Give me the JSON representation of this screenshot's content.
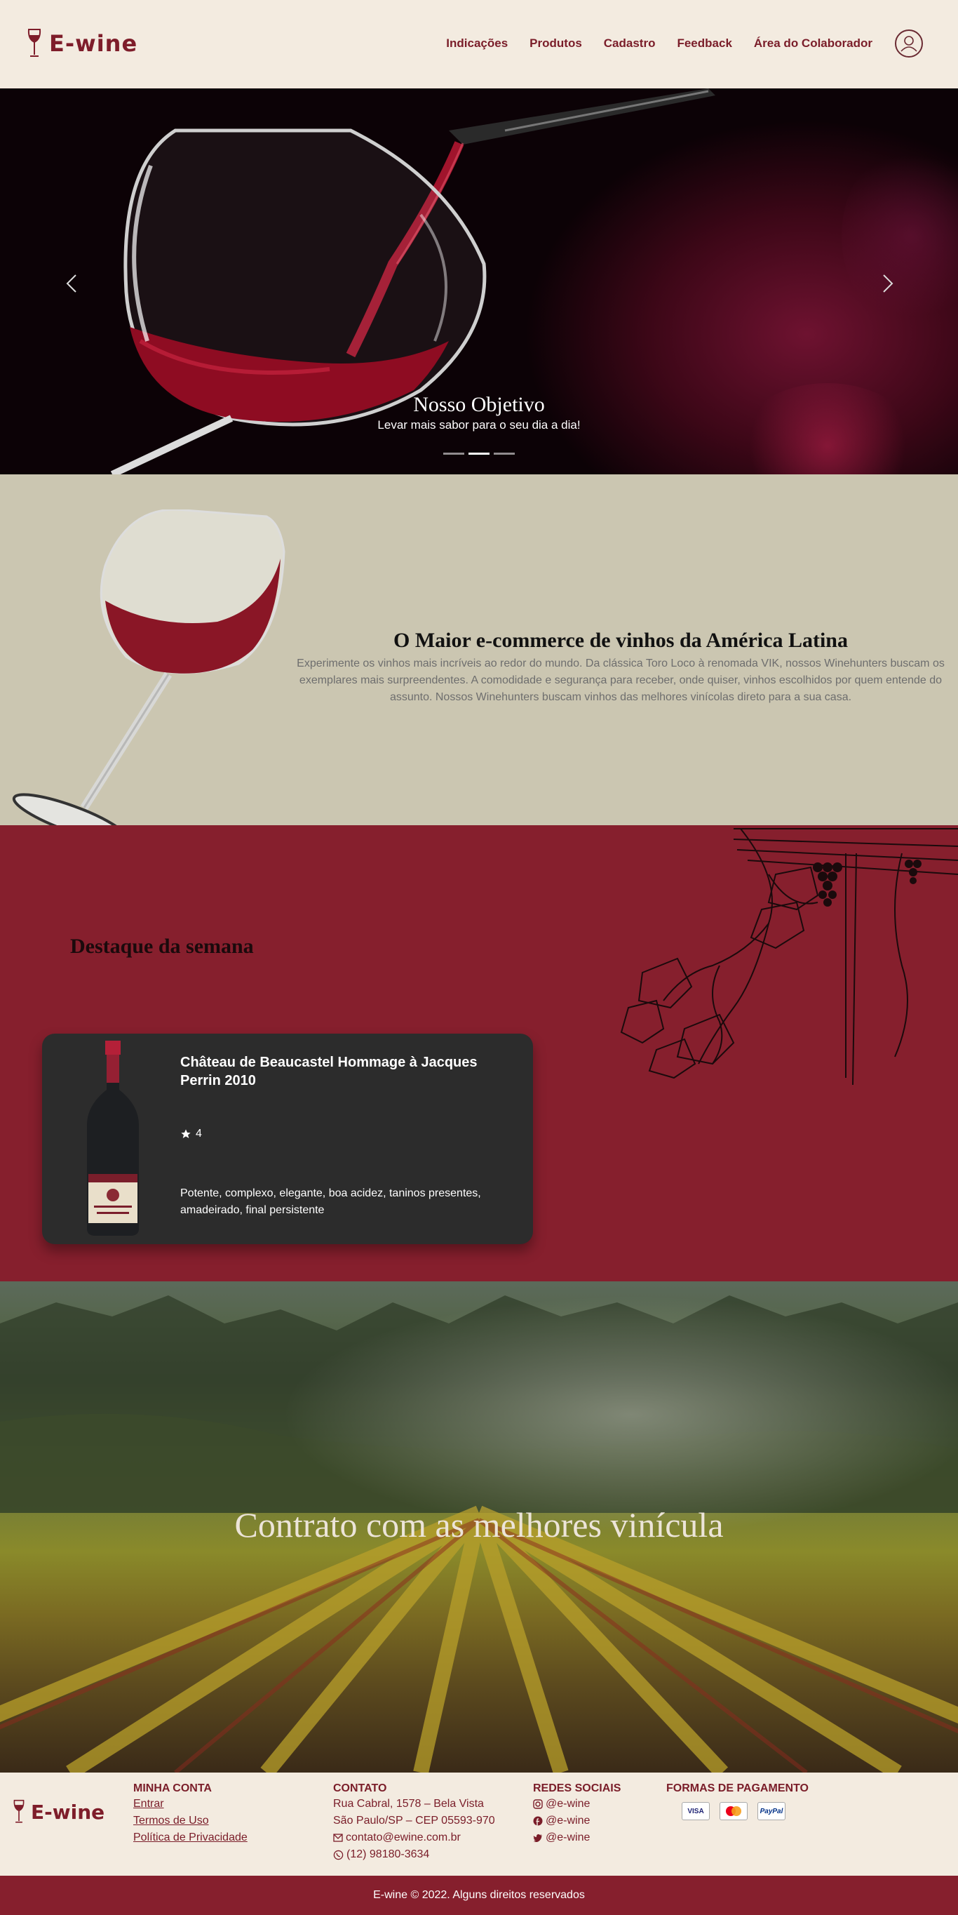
{
  "brand": {
    "name": "E-wine",
    "color": "#7e1d2a"
  },
  "nav": {
    "links": [
      "Indicações",
      "Produtos",
      "Cadastro",
      "Feedback",
      "Área do Colaborador"
    ],
    "profile_icon": "user-circle-icon"
  },
  "hero": {
    "title": "Nosso Objetivo",
    "subtitle": "Levar mais sabor para o seu dia a dia!",
    "slides": 3,
    "active_slide": 1
  },
  "about": {
    "title": "O Maior e-commerce de vinhos da América Latina",
    "text": "Experimente os vinhos mais incríveis ao redor do mundo. Da clássica Toro Loco à renomada VIK, nossos Winehunters buscam os exemplares mais surpreendentes. A comodidade e segurança para receber, onde quiser, vinhos escolhidos por quem entende do assunto. Nossos Winehunters buscam vinhos das melhores vinícolas direto para a sua casa.",
    "background": "#cbc6b1"
  },
  "featured": {
    "title": "Destaque da semana",
    "background": "#861f2d",
    "product": {
      "name": "Château de Beaucastel Hommage à Jacques Perrin 2010",
      "rating": "4",
      "description": "Potente, complexo, elegante, boa acidez, taninos presentes, amadeirado, final persistente"
    }
  },
  "vineyard": {
    "title": "Contrato com as melhores vinícula"
  },
  "footer": {
    "account": {
      "heading": "MINHA CONTA",
      "links": [
        "Entrar",
        "Termos de Uso",
        "Política de Privacidade"
      ]
    },
    "contact": {
      "heading": "CONTATO",
      "address1": "Rua Cabral, 1578 – Bela Vista",
      "address2": "São Paulo/SP – CEP 05593-970",
      "email": "contato@ewine.com.br",
      "phone": "(12) 98180-3634"
    },
    "social": {
      "heading": "REDES SOCIAIS",
      "instagram": "@e-wine",
      "facebook": "@e-wine",
      "twitter": "@e-wine"
    },
    "payment": {
      "heading": "FORMAS DE PAGAMENTO",
      "methods": [
        "VISA",
        "MasterCard",
        "PayPal"
      ]
    },
    "copyright": "E-wine © 2022. Alguns direitos reservados"
  }
}
